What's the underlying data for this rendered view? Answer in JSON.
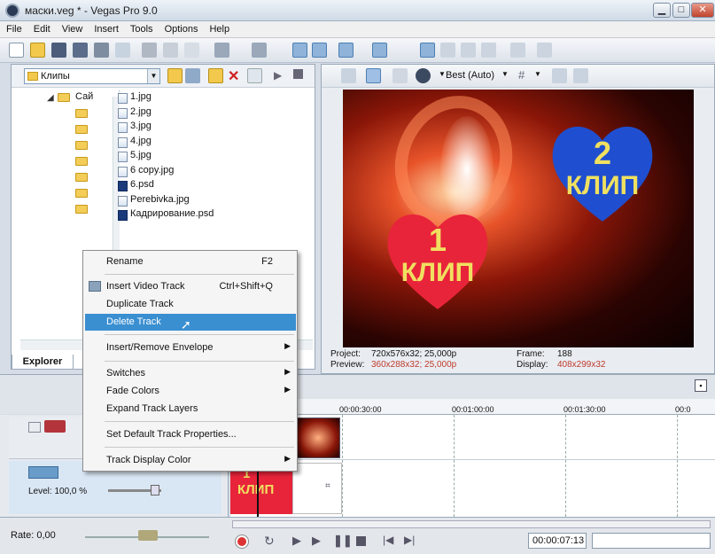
{
  "window": {
    "title": "маски.veg * - Vegas Pro 9.0",
    "buttons": {
      "minimize": "▁",
      "maximize": "□",
      "close": "✕"
    }
  },
  "menu": [
    "File",
    "Edit",
    "View",
    "Insert",
    "Tools",
    "Options",
    "Help"
  ],
  "explorer": {
    "folder": "Клипы",
    "tree_label": "Сай",
    "files": [
      {
        "name": "1.jpg",
        "type": "image"
      },
      {
        "name": "2.jpg",
        "type": "image"
      },
      {
        "name": "3.jpg",
        "type": "image"
      },
      {
        "name": "4.jpg",
        "type": "image"
      },
      {
        "name": "5.jpg",
        "type": "image"
      },
      {
        "name": "6 copy.jpg",
        "type": "image"
      },
      {
        "name": "6.psd",
        "type": "psd"
      },
      {
        "name": "Perebivka.jpg",
        "type": "image"
      },
      {
        "name": "Кадрирование.psd",
        "type": "psd"
      }
    ],
    "tab": "Explorer"
  },
  "preview": {
    "quality": "Best (Auto)",
    "hearts": [
      {
        "number": "1",
        "word": "КЛИП",
        "color": "#e8243a"
      },
      {
        "number": "2",
        "word": "КЛИП",
        "color": "#1f4fd0"
      }
    ],
    "project_label": "Project:",
    "project_value": "720x576x32; 25,000p",
    "preview_label": "Preview:",
    "preview_value": "360x288x32; 25,000p",
    "frame_label": "Frame:",
    "frame_value": "188",
    "display_label": "Display:",
    "display_value": "408x299x32"
  },
  "context_menu": {
    "items": [
      {
        "label": "Rename",
        "shortcut": "F2",
        "ul": "R"
      },
      {
        "label": "Insert Video Track",
        "shortcut": "Ctrl+Shift+Q"
      },
      {
        "label": "Duplicate Track",
        "shortcut": ""
      },
      {
        "label": "Delete Track",
        "shortcut": "",
        "highlighted": true
      },
      {
        "label": "Insert/Remove Envelope",
        "submenu": true
      },
      {
        "label": "Switches",
        "submenu": true
      },
      {
        "label": "Fade Colors",
        "submenu": true
      },
      {
        "label": "Expand Track Layers",
        "shortcut": ""
      },
      {
        "label": "Set Default Track Properties...",
        "shortcut": ""
      },
      {
        "label": "Track Display Color",
        "submenu": true
      }
    ]
  },
  "timeline": {
    "ruler": [
      "00:00:30:00",
      "00:01:00:00",
      "00:01:30:00",
      "00:0"
    ],
    "level": "Level: 100,0 %",
    "clip_text_number": "1",
    "clip_text_word": "КЛИП",
    "rate": "Rate: 0,00",
    "timecode": "00:00:07:13"
  },
  "colors": {
    "accent_highlight": "#3a8fd1",
    "red_info": "#c0392b"
  }
}
